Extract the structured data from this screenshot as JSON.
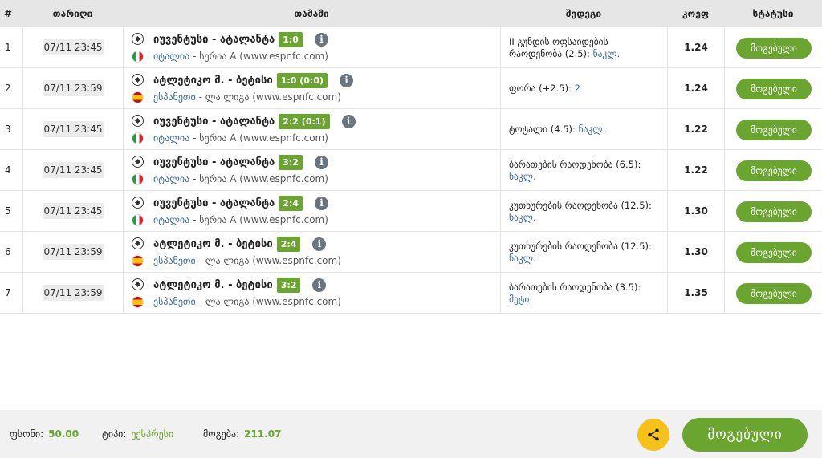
{
  "header": {
    "num": "#",
    "date": "თარიღი",
    "game": "თამაში",
    "bet": "შედეგი",
    "coef": "კოეფ",
    "status": "სტატუსი"
  },
  "rows": [
    {
      "num": "1",
      "date": "07/11 23:45",
      "teams": "იუვენტუსი - ატალანტა",
      "score": "1:0",
      "country": "იტალია",
      "league": "- სერია A (www.espnfc.com)",
      "bet_text": "II გუნდის ოფსაიდების რაოდენობა  (2.5):",
      "bet_acc": "ნაკლ.",
      "coef": "1.24",
      "status": "მოგებული"
    },
    {
      "num": "2",
      "date": "07/11 23:59",
      "teams": "ატლეტიკო მ. - ბეტისი",
      "score": "1:0 (0:0)",
      "country": "ესპანეთი",
      "league": "- ლა ლიგა (www.espnfc.com)",
      "bet_text": "ფორა  (+2.5):",
      "bet_acc": "2",
      "coef": "1.24",
      "status": "მოგებული"
    },
    {
      "num": "3",
      "date": "07/11 23:45",
      "teams": "იუვენტუსი - ატალანტა",
      "score": "2:2 (0:1)",
      "country": "იტალია",
      "league": "- სერია A (www.espnfc.com)",
      "bet_text": "ტოტალი  (4.5):",
      "bet_acc": "ნაკლ.",
      "coef": "1.22",
      "status": "მოგებული"
    },
    {
      "num": "4",
      "date": "07/11 23:45",
      "teams": "იუვენტუსი - ატალანტა",
      "score": "3:2",
      "country": "იტალია",
      "league": "- სერია A (www.espnfc.com)",
      "bet_text": "ბარათების რაოდენობა  (6.5):",
      "bet_acc": "ნაკლ.",
      "coef": "1.22",
      "status": "მოგებული"
    },
    {
      "num": "5",
      "date": "07/11 23:45",
      "teams": "იუვენტუსი - ატალანტა",
      "score": "2:4",
      "country": "იტალია",
      "league": "- სერია A (www.espnfc.com)",
      "bet_text": "კუთხურების რაოდენობა  (12.5):",
      "bet_acc": "ნაკლ.",
      "coef": "1.30",
      "status": "მოგებული"
    },
    {
      "num": "6",
      "date": "07/11 23:59",
      "teams": "ატლეტიკო მ. - ბეტისი",
      "score": "2:4",
      "country": "ესპანეთი",
      "league": "- ლა ლიგა (www.espnfc.com)",
      "bet_text": "კუთხურების რაოდენობა  (12.5):",
      "bet_acc": "ნაკლ.",
      "coef": "1.30",
      "status": "მოგებული"
    },
    {
      "num": "7",
      "date": "07/11 23:59",
      "teams": "ატლეტიკო მ. - ბეტისი",
      "score": "3:2",
      "country": "ესპანეთი",
      "league": "- ლა ლიგა (www.espnfc.com)",
      "bet_text": "ბარათების რაოდენობა  (3.5):",
      "bet_acc": "მეტი",
      "coef": "1.35",
      "status": "მოგებული"
    }
  ],
  "footer": {
    "stake_label": "ფსონი:",
    "stake_value": "50.00",
    "type_label": "ტიპი:",
    "type_value": "ექსპრესი",
    "win_label": "მოგება:",
    "win_value": "211.07",
    "status_button": "მოგებული"
  },
  "colors": {
    "accent_green": "#6aa52f",
    "share_yellow": "#f6c21a",
    "link_blue": "#3b6aa0"
  }
}
